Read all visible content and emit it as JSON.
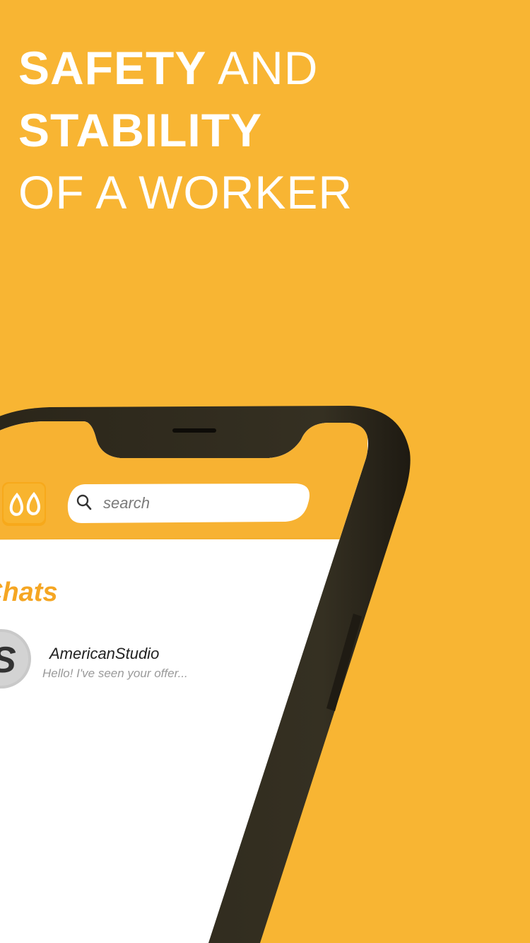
{
  "promo": {
    "line1_bold": "SAFETY",
    "line1_light": "AND",
    "line2_bold": "STABILITY",
    "line3_light": "OF A WORKER"
  },
  "app": {
    "search": {
      "placeholder": "search",
      "icon": "search-icon"
    },
    "logo_icon": "app-logo-icon",
    "section_title": "Chats",
    "chats": [
      {
        "avatar_letter": "S",
        "name": "AmericanStudio",
        "preview": "Hello! I've seen your offer..."
      }
    ]
  },
  "colors": {
    "brand_yellow": "#f8b533",
    "header_yellow": "#f7b232",
    "chats_title_orange": "#f5a623",
    "phone_frame": "#2f2a1e",
    "screen_bg": "#ffffff"
  }
}
